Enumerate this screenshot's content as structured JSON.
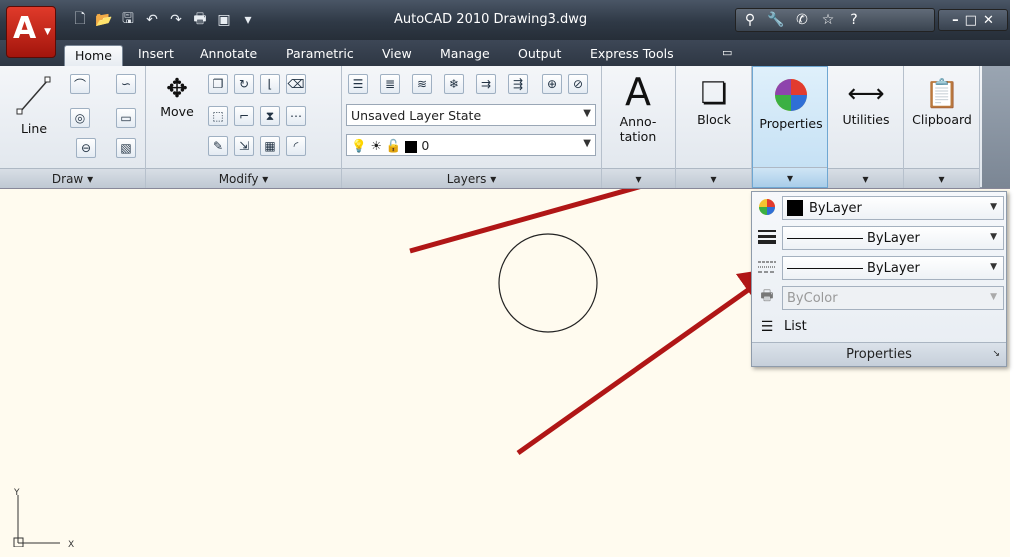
{
  "window": {
    "title": "AutoCAD 2010   Drawing3.dwg"
  },
  "app_button": {
    "logo": "A",
    "icon": "autocad-logo-icon"
  },
  "quick_access": [
    "new-icon",
    "open-icon",
    "save-icon",
    "undo-icon",
    "redo-icon",
    "plot-icon",
    "publish-pdf-icon",
    "dropdown-icon"
  ],
  "tabs": [
    "Home",
    "Insert",
    "Annotate",
    "Parametric",
    "View",
    "Manage",
    "Output",
    "Express Tools"
  ],
  "active_tab": "Home",
  "panels": {
    "draw": {
      "title": "Draw ▾",
      "line_label": "Line"
    },
    "modify": {
      "title": "Modify ▾",
      "move_label": "Move"
    },
    "layers": {
      "title": "Layers ▾",
      "layer_state": "Unsaved Layer State",
      "current_layer": "0"
    },
    "annotation": {
      "label_line1": "Anno-",
      "label_line2": "tation"
    },
    "block": {
      "label": "Block"
    },
    "properties": {
      "label": "Properties"
    },
    "utilities": {
      "label": "Utilities"
    },
    "clipboard": {
      "label": "Clipboard"
    }
  },
  "properties_dropdown": {
    "color": "ByLayer",
    "lineweight": "ByLayer",
    "linetype": "ByLayer",
    "plot_style": "ByColor",
    "list_label": "List",
    "title": "Properties"
  },
  "ucs": {
    "y_label": "Y",
    "x_label": "X"
  },
  "colors": {
    "arrow": "#b01616",
    "drawing_bg": "#fffbef",
    "highlight": "#c1def3"
  }
}
